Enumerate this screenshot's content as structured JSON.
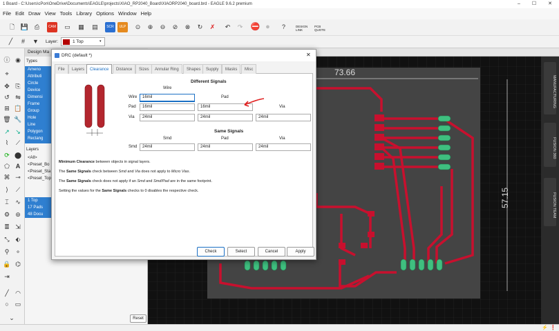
{
  "titlebar": {
    "title": "1 Board - C:\\Users\\cPon\\OneDrive\\Documents\\EAGLE\\projects\\XIAO_RP2040_Board\\XIAORP2040_board.brd - EAGLE 9.6.2 premium"
  },
  "menu": [
    "File",
    "Edit",
    "Draw",
    "View",
    "Tools",
    "Library",
    "Options",
    "Window",
    "Help"
  ],
  "layer_bar": {
    "label": "Layer:",
    "value": "1 Top"
  },
  "design_manager": {
    "title": "Design Ma",
    "types_label": "Types",
    "types": [
      "Ameno",
      "Attributi",
      "Circle",
      "Device",
      "Dimensi",
      "Frame",
      "Group",
      "Hole",
      "Line",
      "Polygon",
      "Rectang"
    ],
    "layers_label": "Layers",
    "layers": [
      "<All>",
      "<Preset_Bo",
      "<Preset_Sta",
      "<Preset_Top"
    ],
    "layer_rows": [
      "1 Top",
      "17 Pads",
      "48 Docu"
    ],
    "reset_label": "Reset"
  },
  "dialog": {
    "title": "DRC (default *)",
    "tabs": [
      "File",
      "Layers",
      "Clearance",
      "Distance",
      "Sizes",
      "Annular Ring",
      "Shapes",
      "Supply",
      "Masks",
      "Misc"
    ],
    "active_tab": "Clearance",
    "different_signals": {
      "heading": "Different Signals",
      "col_wire": "Wire",
      "col_pad": "Pad",
      "col_via": "Via",
      "rows": [
        {
          "label": "Wire",
          "values": [
            "16mil"
          ]
        },
        {
          "label": "Pad",
          "values": [
            "16mil",
            "16mil"
          ]
        },
        {
          "label": "Via",
          "values": [
            "24mil",
            "24mil",
            "24mil"
          ]
        }
      ]
    },
    "same_signals": {
      "heading": "Same Signals",
      "col_smd": "Smd",
      "col_pad": "Pad",
      "col_via": "Via",
      "rows": [
        {
          "label": "Smd",
          "values": [
            "24mil",
            "24mil",
            "24mil"
          ]
        }
      ]
    },
    "desc1_b": "Minimum Clearance",
    "desc1": " between objects in signal layers.",
    "desc2_a": "The ",
    "desc2_b": "Same Signals",
    "desc2_c": " check between ",
    "desc2_i1": "Smd",
    "desc2_d": " and ",
    "desc2_i2": "Via",
    "desc2_e": " does not apply to ",
    "desc2_i3": "Micro Vias",
    "desc2_f": ".",
    "desc3_a": "The ",
    "desc3_b": "Same Signals",
    "desc3_c": " check does not apply if an ",
    "desc3_i1": "Smd",
    "desc3_d": " and ",
    "desc3_i2": "Smd/Pad",
    "desc3_e": " are in the same footprint.",
    "desc4_a": "Setting the values for the ",
    "desc4_b": "Same Signals",
    "desc4_c": " checks to 0 disables the respective check.",
    "buttons": {
      "check": "Check",
      "select": "Select",
      "cancel": "Cancel",
      "apply": "Apply"
    }
  },
  "pcb": {
    "dim_width": "73.66",
    "dim_height": "57.15",
    "trace_color": "#c8102e",
    "pad_color": "#3fbf7f"
  },
  "fusion": {
    "manufacturing": "MANUFACTURING",
    "fusion360": "FUSION 360",
    "fusion_team": "FUSION TEAM"
  },
  "toolbar_labels": {
    "design_link": "DESIGN LINK",
    "pcb_quote": "PCB QUOTE"
  }
}
